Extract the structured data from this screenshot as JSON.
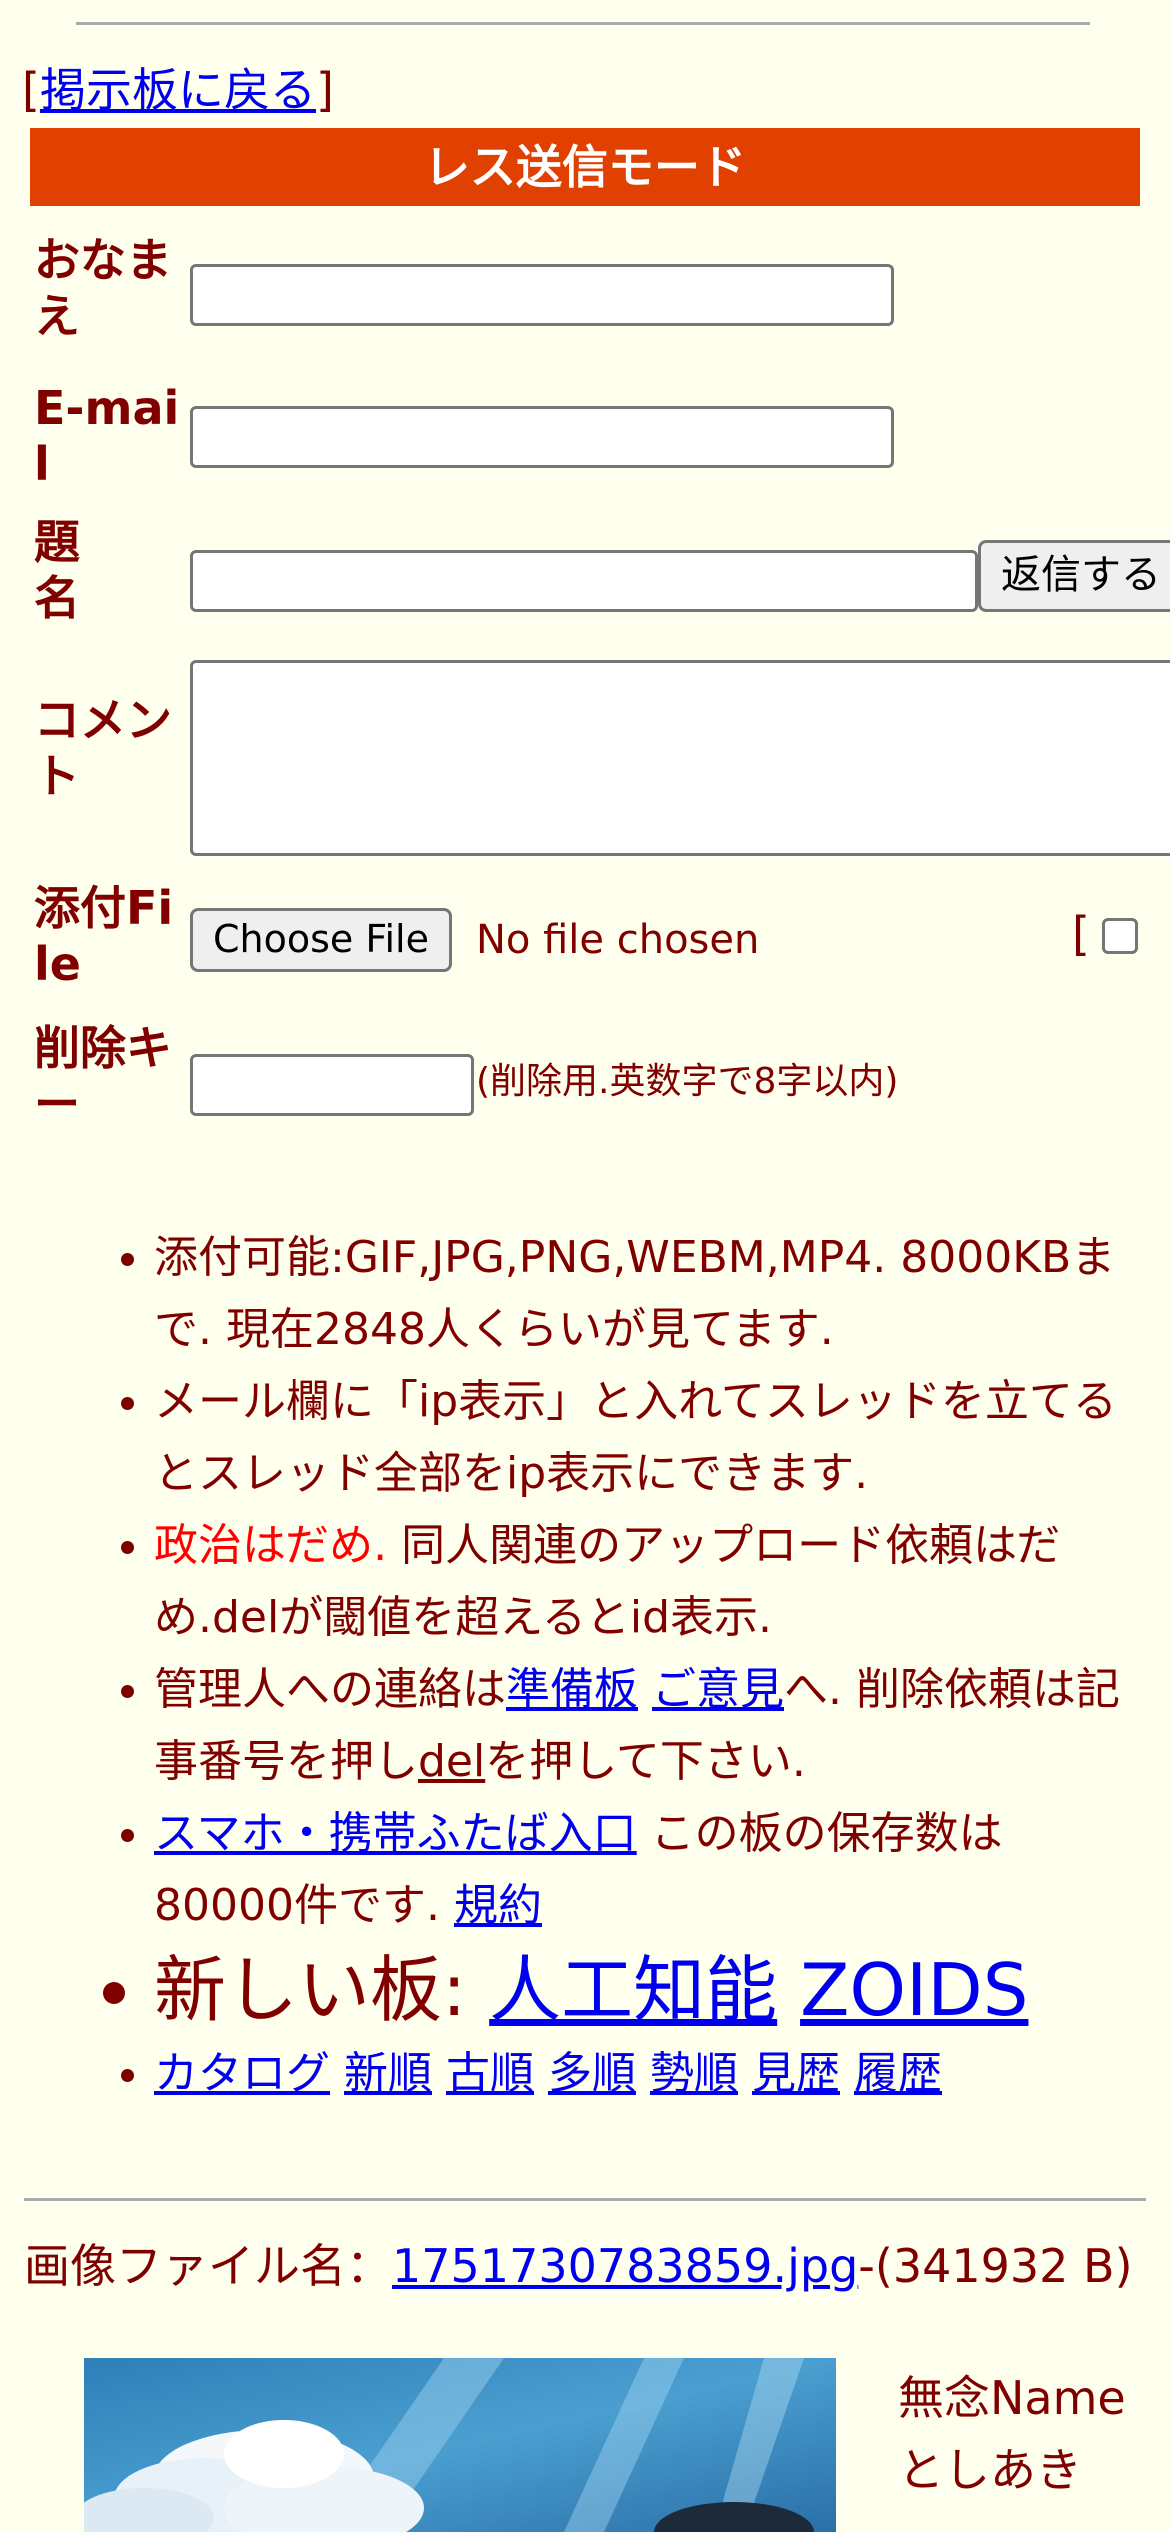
{
  "back_link": {
    "open_bracket": "[",
    "label": "掲示板に戻る",
    "close_bracket": "]"
  },
  "mode_title": "レス送信モード",
  "form": {
    "name_label": "おなまえ",
    "email_label": "E-mail",
    "subject_label": "題名",
    "submit_label": "返信する",
    "comment_label": "コメント",
    "file_label": "添付File",
    "choose_file_label": "Choose File",
    "no_file_text": "No file chosen",
    "extra_open_bracket": "[",
    "delete_key_label": "削除キー",
    "delete_key_note": "(削除用.英数字で8字以内)"
  },
  "notes": {
    "item1": "添付可能:GIF,JPG,PNG,WEBM,MP4. 8000KBまで. 現在2848人くらいが見てます.",
    "item2": "メール欄に「ip表示」と入れてスレッドを立てるとスレッド全部をip表示にできます.",
    "item3_red": "政治はだめ.",
    "item3_rest": " 同人関連のアップロード依頼はだめ.delが閾値を超えるとid表示.",
    "item4_a": "管理人への連絡は",
    "item4_link1": "準備板",
    "item4_link2": "ご意見",
    "item4_b": "へ. 削除依頼は記事番号を押し",
    "item4_link3": "del",
    "item4_c": "を押して下さい.",
    "item5_link": "スマホ・携帯ふたば入口",
    "item5_a": " この板の保存数は80000件です. ",
    "item5_link2": "規約",
    "item6_prefix": "新しい板: ",
    "item6_link1": "人工知能",
    "item6_link2": "ZOIDS",
    "item7_links": [
      "カタログ",
      "新順",
      "古順",
      "多順",
      "勢順",
      "見歴",
      "履歴"
    ]
  },
  "post": {
    "file_prefix": "画像ファイル名：",
    "file_name": "1751730783859.jpg",
    "file_size": "-(341932 B)",
    "poster_name": "無念Name",
    "poster_sub": "としあき"
  }
}
